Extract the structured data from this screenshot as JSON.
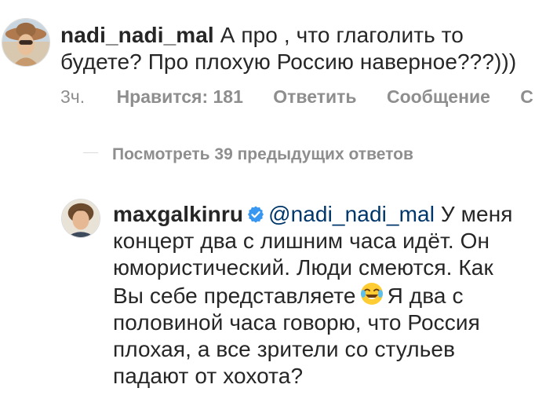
{
  "comment1": {
    "username": "nadi_nadi_mal",
    "text_line1": "А про , что глаголить то",
    "text_line2": "будете? Про плохую Россию  наверное???)))",
    "avatar_icon": "user-avatar-woman-sunhat"
  },
  "comment1_meta": {
    "time": "3ч.",
    "likes": "Нравится: 181",
    "reply": "Ответить",
    "message": "Сообщение",
    "cut": "С"
  },
  "replies": {
    "view_label": "Посмотреть 39 предыдущих ответов"
  },
  "comment2": {
    "username": "maxgalkinru",
    "verified_icon": "verified-badge-icon",
    "mention": "@nadi_nadi_mal",
    "line1_rest": " У меня",
    "line2": "концерт два с лишним часа идёт. Он",
    "line3": "юмористический. Люди смеются. Как",
    "line4_a": "Вы себе представляете",
    "emoji_icon": "tears-of-joy-emoji",
    "line4_b": "Я два с",
    "line5": "половиной часа говорю, что Россия",
    "line6": "плохая, а все зрители со стульев",
    "line7": "падают от хохота?",
    "avatar_icon": "user-avatar-man-curly-hair"
  },
  "colors": {
    "text": "#262626",
    "muted": "#8e8e8e",
    "mention": "#00376b",
    "verified": "#3897f0"
  }
}
